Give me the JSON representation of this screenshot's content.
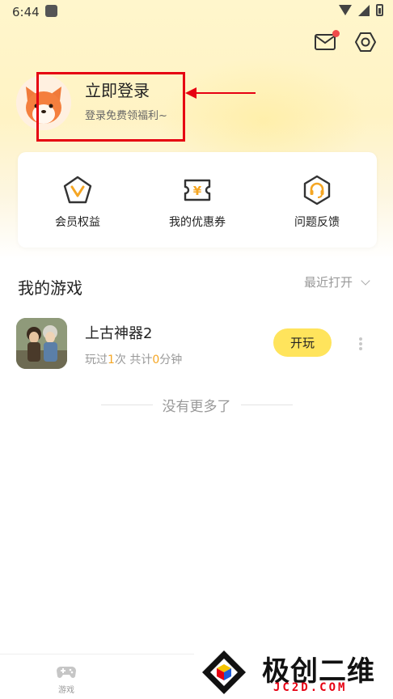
{
  "status_bar": {
    "time": "6:44"
  },
  "header": {
    "mail_icon": "mail-icon",
    "settings_icon": "settings-icon",
    "accent": "#ffe45c",
    "notification_color": "#f04b4b"
  },
  "profile": {
    "title": "立即登录",
    "subtitle": "登录免费领福利~"
  },
  "benefits": [
    {
      "label": "会员权益",
      "icon": "vip-icon"
    },
    {
      "label": "我的优惠券",
      "icon": "coupon-icon"
    },
    {
      "label": "问题反馈",
      "icon": "feedback-icon"
    }
  ],
  "my_games": {
    "title": "我的游戏",
    "sort_label": "最近打开",
    "games": [
      {
        "name": "上古神器2",
        "stats_prefix": "玩过",
        "plays": "1",
        "plays_unit": "次 共计",
        "minutes": "0",
        "minutes_unit": "分钟",
        "play_label": "开玩"
      }
    ],
    "end_text": "没有更多了"
  },
  "bottom_nav": {
    "items": [
      {
        "label": "游戏",
        "icon": "gamepad-icon"
      }
    ]
  },
  "watermark": {
    "title": "极创二维",
    "url": "JC2D.COM"
  }
}
